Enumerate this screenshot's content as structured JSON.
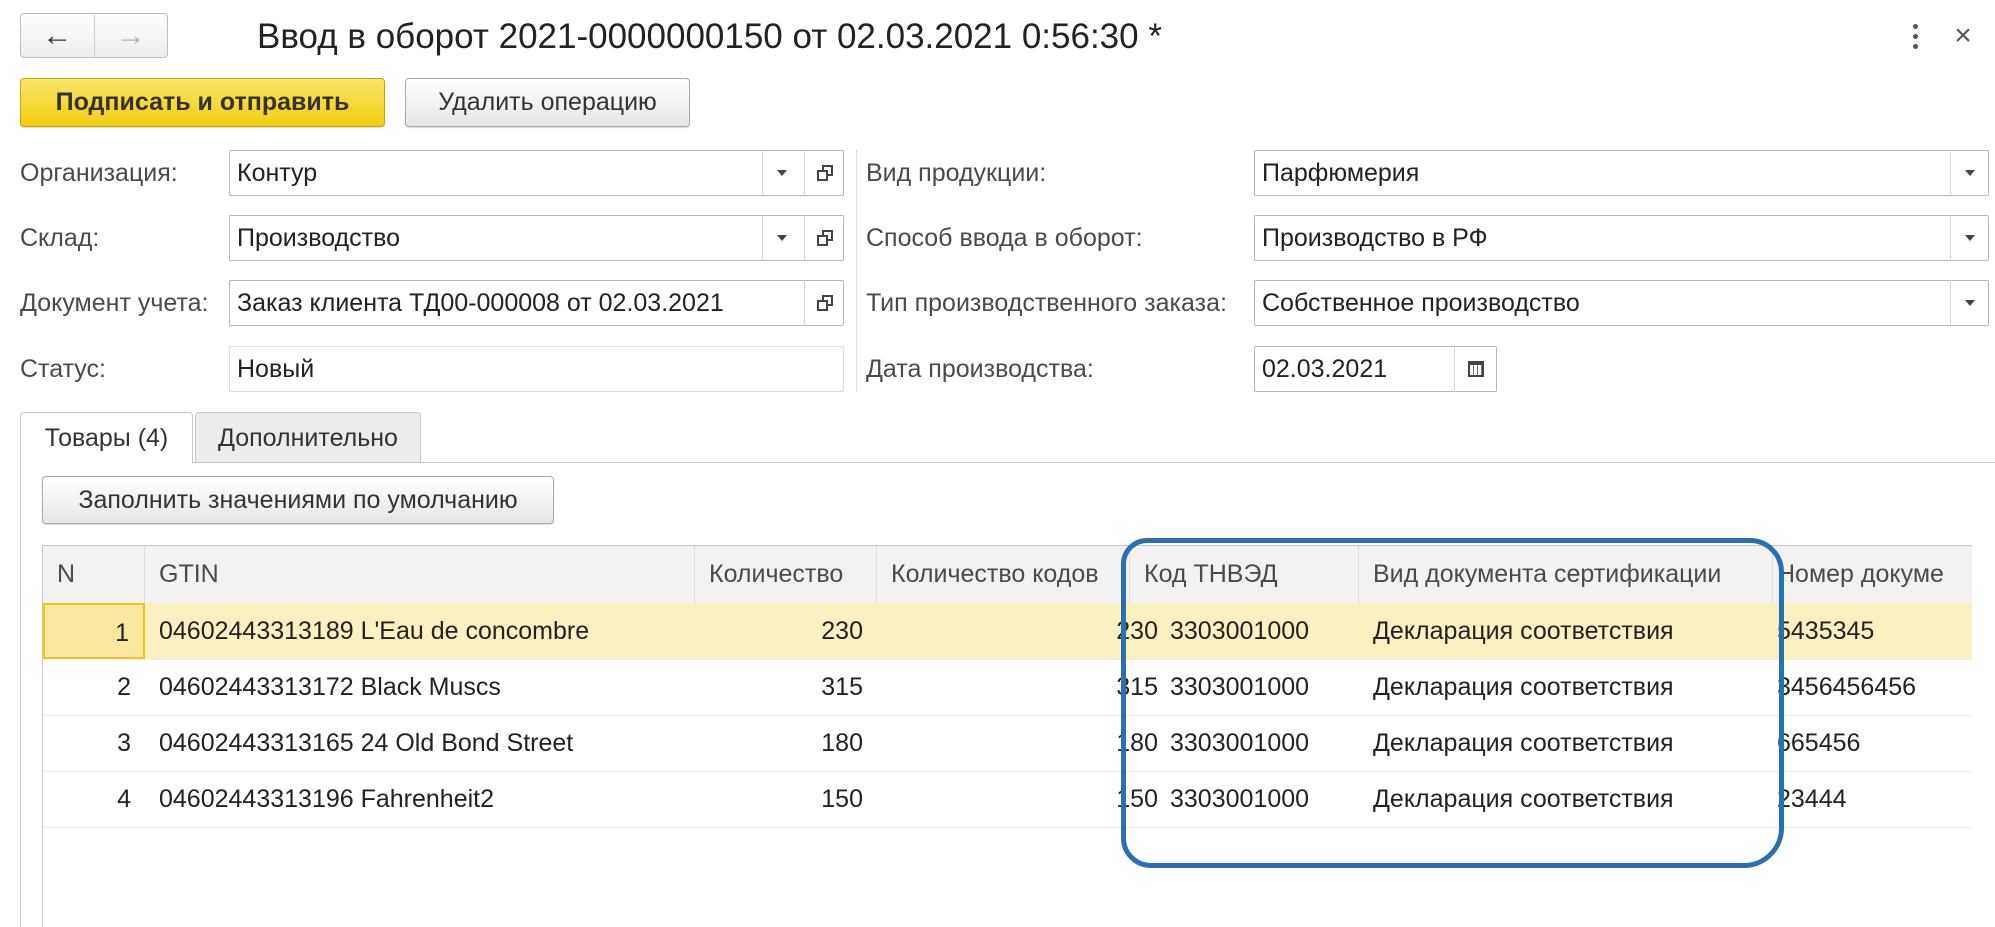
{
  "window": {
    "title": "Ввод в оборот 2021-0000000150 от 02.03.2021 0:56:30 *",
    "nav_back": "←",
    "nav_forward": "→",
    "close": "×"
  },
  "toolbar": {
    "sign_send": "Подписать и отправить",
    "delete_op": "Удалить операцию"
  },
  "form": {
    "org": {
      "label": "Организация:",
      "value": "Контур"
    },
    "warehouse": {
      "label": "Склад:",
      "value": "Производство"
    },
    "doc": {
      "label": "Документ учета:",
      "value": "Заказ клиента ТД00-000008 от 02.03.2021"
    },
    "status": {
      "label": "Статус:",
      "value": "Новый"
    },
    "product_kind": {
      "label": "Вид продукции:",
      "value": "Парфюмерия"
    },
    "input_method": {
      "label": "Способ ввода в оборот:",
      "value": "Производство в РФ"
    },
    "order_type": {
      "label": "Тип производственного заказа:",
      "value": "Собственное производство"
    },
    "prod_date": {
      "label": "Дата производства:",
      "value": "02.03.2021"
    }
  },
  "tabs": [
    {
      "label": "Товары (4)"
    },
    {
      "label": "Дополнительно"
    }
  ],
  "goods": {
    "fill_defaults": "Заполнить значениями по умолчанию",
    "columns": [
      "N",
      "GTIN",
      "Количество",
      "Количество кодов",
      "Код ТНВЭД",
      "Вид документа сертификации",
      "Номер докуме"
    ],
    "rows": [
      [
        "1",
        "04602443313189 L'Eau de concombre",
        "230",
        "230",
        "3303001000",
        "Декларация соответствия",
        "5435345"
      ],
      [
        "2",
        "04602443313172 Black Muscs",
        "315",
        "315",
        "3303001000",
        "Декларация соответствия",
        "3456456456"
      ],
      [
        "3",
        "04602443313165 24 Old Bond Street",
        "180",
        "180",
        "3303001000",
        "Декларация соответствия",
        "665456"
      ],
      [
        "4",
        "04602443313196 Fahrenheit2",
        "150",
        "150",
        "3303001000",
        "Декларация соответствия",
        "23444"
      ]
    ]
  },
  "colors": {
    "primary_button": "#f1cd0e",
    "selected_row": "#fbf0c0",
    "annotation": "#2a6fb0"
  }
}
